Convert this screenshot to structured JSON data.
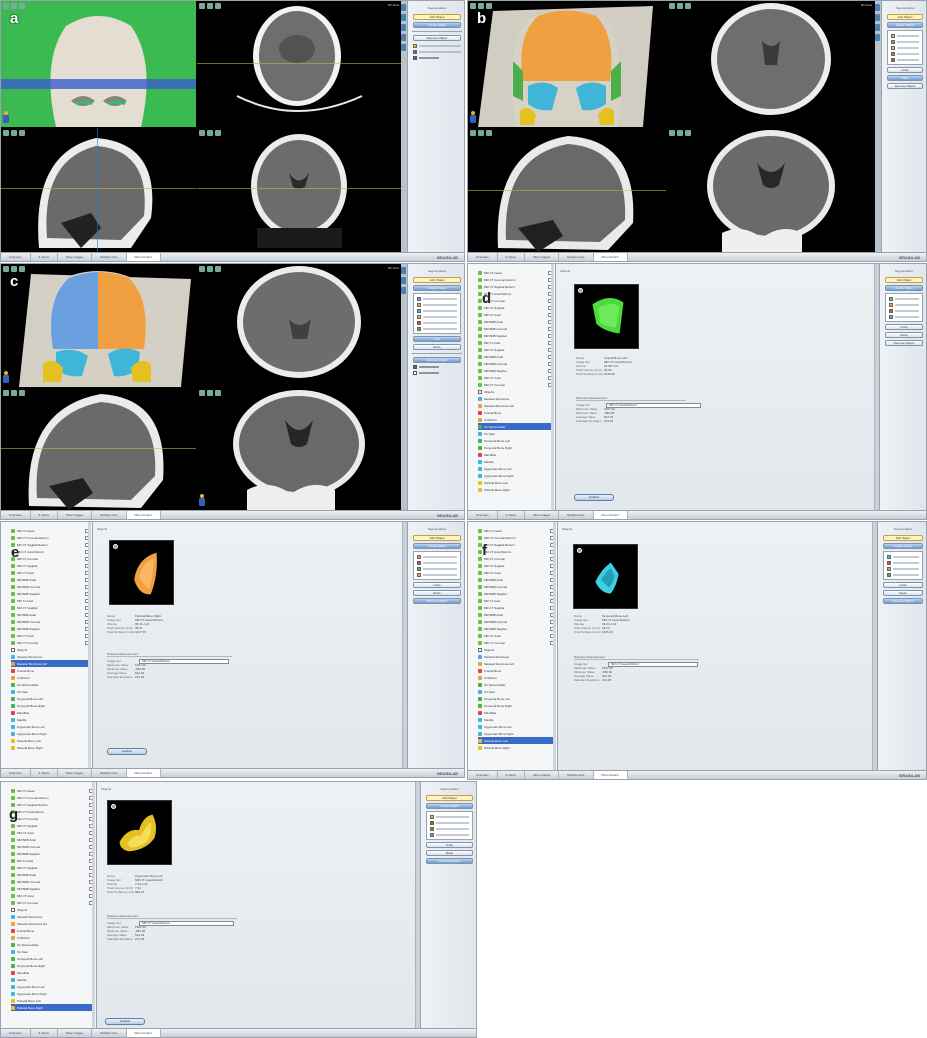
{
  "labels": {
    "a": "a",
    "b": "b",
    "c": "c",
    "d": "d",
    "e": "e",
    "f": "f",
    "g": "g"
  },
  "viewer": {
    "tabs": [
      "Overview",
      "3 Views",
      "Slice Images",
      "Multiple Cuts",
      "Plan Content"
    ],
    "brand": "BRAINLAB",
    "axial_info": "3D View",
    "side_title": "Segmentation",
    "side_buttons": [
      "Add Object",
      "Create Object",
      "Remove Object",
      "Undo",
      "Redo"
    ]
  },
  "object_panel": {
    "header": "Objects",
    "tree_group": "Objects",
    "tree_folders": [
      "MR CT Head",
      "MR CT Coronal Reform",
      "MR CT Sagittal Reform",
      "MR CT Axial Reform",
      "MR CT Coronal",
      "MR CT Sagittal",
      "MR CT Axial",
      "MR BRB Axial",
      "MR BRB Coronal",
      "MR BRB Sagittal",
      "MR T1 Axial",
      "MR CT Sagittal",
      "MR BRB Axial",
      "MR BRB Coronal",
      "MR BRB Sagittal",
      "MR CT Axial",
      "MR CT Coronal"
    ],
    "tree_objects": [
      "Skeletal Structures",
      "Skeletal Structures left",
      "Frontal Bone",
      "Cribriform",
      "Os Sphenoidale",
      "Os Nasi",
      "Temporal Bone Left",
      "Temporal Bone Right",
      "Mandible",
      "Maxilla",
      "Zygomatic Bone Left",
      "Zygomatic Bone Right",
      "Parietal Bone Left",
      "Parietal Bone Right"
    ],
    "props_labels": [
      "Name",
      "Image Set",
      "Volume",
      "Total Volume (cm3)",
      "Total Surface (mm2)"
    ],
    "meas_header": "Distance Measurement",
    "meas_labels": [
      "Image Set",
      "Maximum Value",
      "Minimum Value",
      "Average Value",
      "Standard Deviation"
    ],
    "select_value": "MR CT Head Reform",
    "ok_label": "Confirm",
    "d_props": [
      "Frontal Bone Left",
      "MR CT Head Reform",
      "25.98 cm3",
      "25.98",
      "2245.36"
    ],
    "e_props": [
      "Parietal Bone Right",
      "MR CT Head Reform",
      "38.41 cm3",
      "38.41",
      "3217.55"
    ],
    "f_props": [
      "Temporal Bone Left",
      "MR CT Head Reform",
      "18.24 cm3",
      "18.24",
      "1825.40"
    ],
    "g_props": [
      "Zygomatic Bone Left",
      "MR CT Head Reform",
      "7.44 cm3",
      "7.44",
      "906.21"
    ],
    "meas_values": [
      "MR CT Head Reform",
      "1507.00",
      "-950.00",
      "512.34",
      "213.45"
    ]
  },
  "colors": {
    "green_bg": "#2fb24a",
    "skull": "#d6d0c4",
    "orange": "#f0a040",
    "cyan": "#3fb5d8",
    "blue_skull": "#6aa0e0",
    "yellow": "#e4c020",
    "neon_green": "#4bdc3c"
  }
}
